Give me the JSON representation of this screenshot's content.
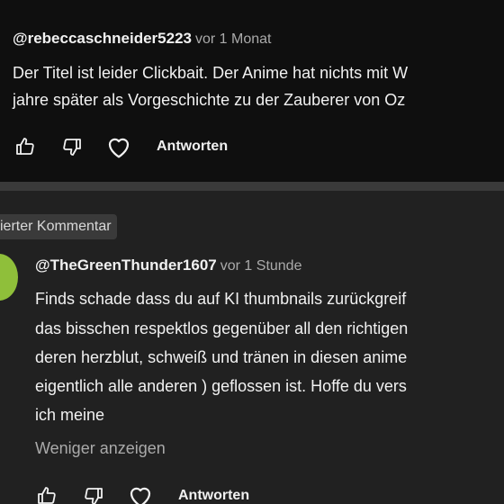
{
  "comment1": {
    "author": "@rebeccaschneider5223",
    "time": "vor 1 Monat",
    "lines": [
      "Der Titel ist leider Clickbait. Der Anime hat nichts mit W",
      "jahre später als Vorgeschichte zu der Zauberer von Oz"
    ],
    "reply_label": "Antworten"
  },
  "comment2": {
    "badge": "ierter Kommentar",
    "author": "@TheGreenThunder1607",
    "time": "vor 1 Stunde",
    "lines": [
      "Finds schade dass du auf KI thumbnails zurückgreif",
      "das bisschen respektlos gegenüber all den richtigen",
      "deren herzblut, schweiß und tränen in diesen anime",
      "eigentlich alle anderen ) geflossen ist. Hoffe du vers",
      "ich meine"
    ],
    "show_less": "Weniger anzeigen",
    "reply_label": "Antworten"
  },
  "icons": [
    "like-icon",
    "dislike-icon",
    "heart-icon"
  ],
  "colors": {
    "background": "#0f0f0f",
    "highlight_background": "#212121",
    "text": "#f1f1f1",
    "secondary_text": "#aaaaaa",
    "avatar": "#8fbf3a"
  }
}
